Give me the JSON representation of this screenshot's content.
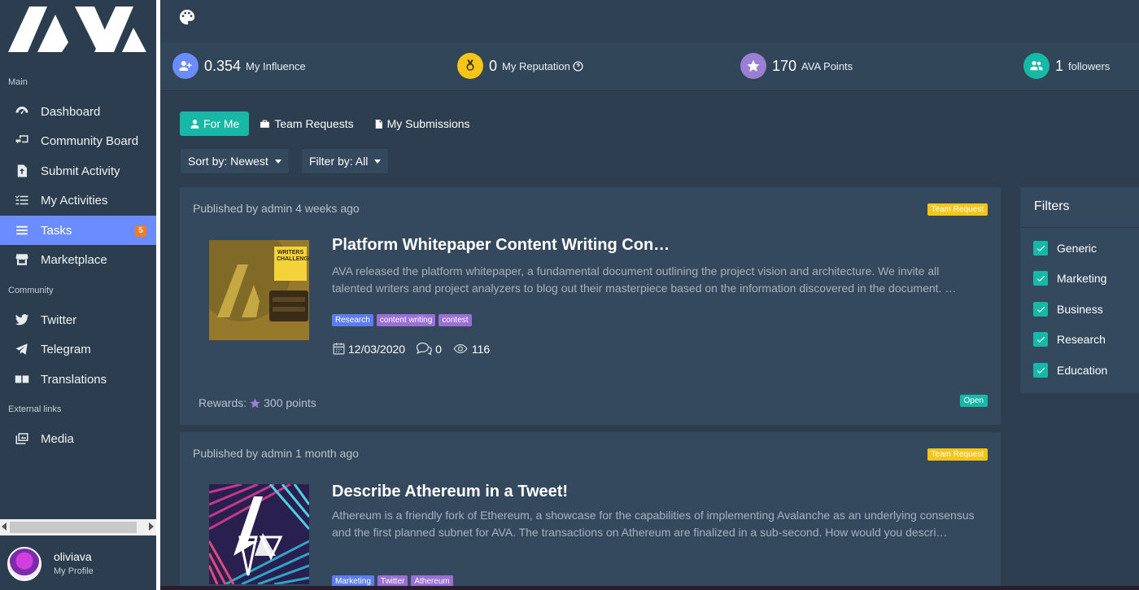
{
  "sidebar": {
    "sections": {
      "main": "Main",
      "community": "Community",
      "external": "External links"
    },
    "items": [
      {
        "label": "Dashboard",
        "icon": "dashboard-icon"
      },
      {
        "label": "Community Board",
        "icon": "community-board-icon"
      },
      {
        "label": "Submit Activity",
        "icon": "upload-file-icon"
      },
      {
        "label": "My Activities",
        "icon": "checklist-icon"
      },
      {
        "label": "Tasks",
        "icon": "tasks-icon",
        "badge": "5"
      },
      {
        "label": "Marketplace",
        "icon": "store-icon"
      },
      {
        "label": "Twitter",
        "icon": "twitter-icon"
      },
      {
        "label": "Telegram",
        "icon": "telegram-icon"
      },
      {
        "label": "Translations",
        "icon": "translate-icon"
      },
      {
        "label": "Media",
        "icon": "media-icon"
      }
    ],
    "profile": {
      "name": "oliviava",
      "sub": "My Profile"
    }
  },
  "stats": [
    {
      "value": "0.354",
      "label": "My Influence",
      "color": "#6b8cff",
      "icon": "add-user-icon"
    },
    {
      "value": "0",
      "label": "My Reputation",
      "color": "#f5c518",
      "icon": "medal-icon"
    },
    {
      "value": "170",
      "label": "AVA Points",
      "color": "#9a7fd3",
      "icon": "star-icon"
    },
    {
      "value": "1",
      "label": "followers",
      "color": "#17b8a6",
      "icon": "group-icon"
    }
  ],
  "tabs": [
    {
      "label": "For Me"
    },
    {
      "label": "Team Requests"
    },
    {
      "label": "My Submissions"
    }
  ],
  "sort_label": "Sort by: Newest",
  "filter_label": "Filter by: All",
  "cards": [
    {
      "published": "Published by admin 4 weeks ago",
      "badge": "Team Request",
      "title": "Platform Whitepaper Content Writing Con…",
      "desc": "AVA released the platform whitepaper, a fundamental document outlining the project vision and architecture. We invite all talented writers and project analyzers to blog out their masterpiece based on the information discovered in the document. …",
      "tags": [
        "Research",
        "content writing",
        "contest"
      ],
      "date": "12/03/2020",
      "comments": "0",
      "views": "116",
      "rewards_label": "Rewards:",
      "rewards_value": "300 points",
      "status": "Open",
      "image_text": "WRITERS CHALLENGE"
    },
    {
      "published": "Published by admin 1 month ago",
      "badge": "Team Request",
      "title": "Describe Athereum in a Tweet!",
      "desc": "Athereum is a friendly fork of Ethereum, a showcase for the capabilities of implementing Avalanche as an underlying consensus and the first planned subnet for AVA. The transactions on Athereum are finalized in a sub-second. How would you descri…",
      "tags": [
        "Marketing",
        "Twitter",
        "Athereum"
      ]
    }
  ],
  "filters": {
    "title": "Filters",
    "items": [
      "Generic",
      "Marketing",
      "Business",
      "Research",
      "Education"
    ]
  },
  "colors": {
    "accent": "#17b8a6",
    "active_nav": "#6b8cff",
    "badge": "#f5c518"
  }
}
